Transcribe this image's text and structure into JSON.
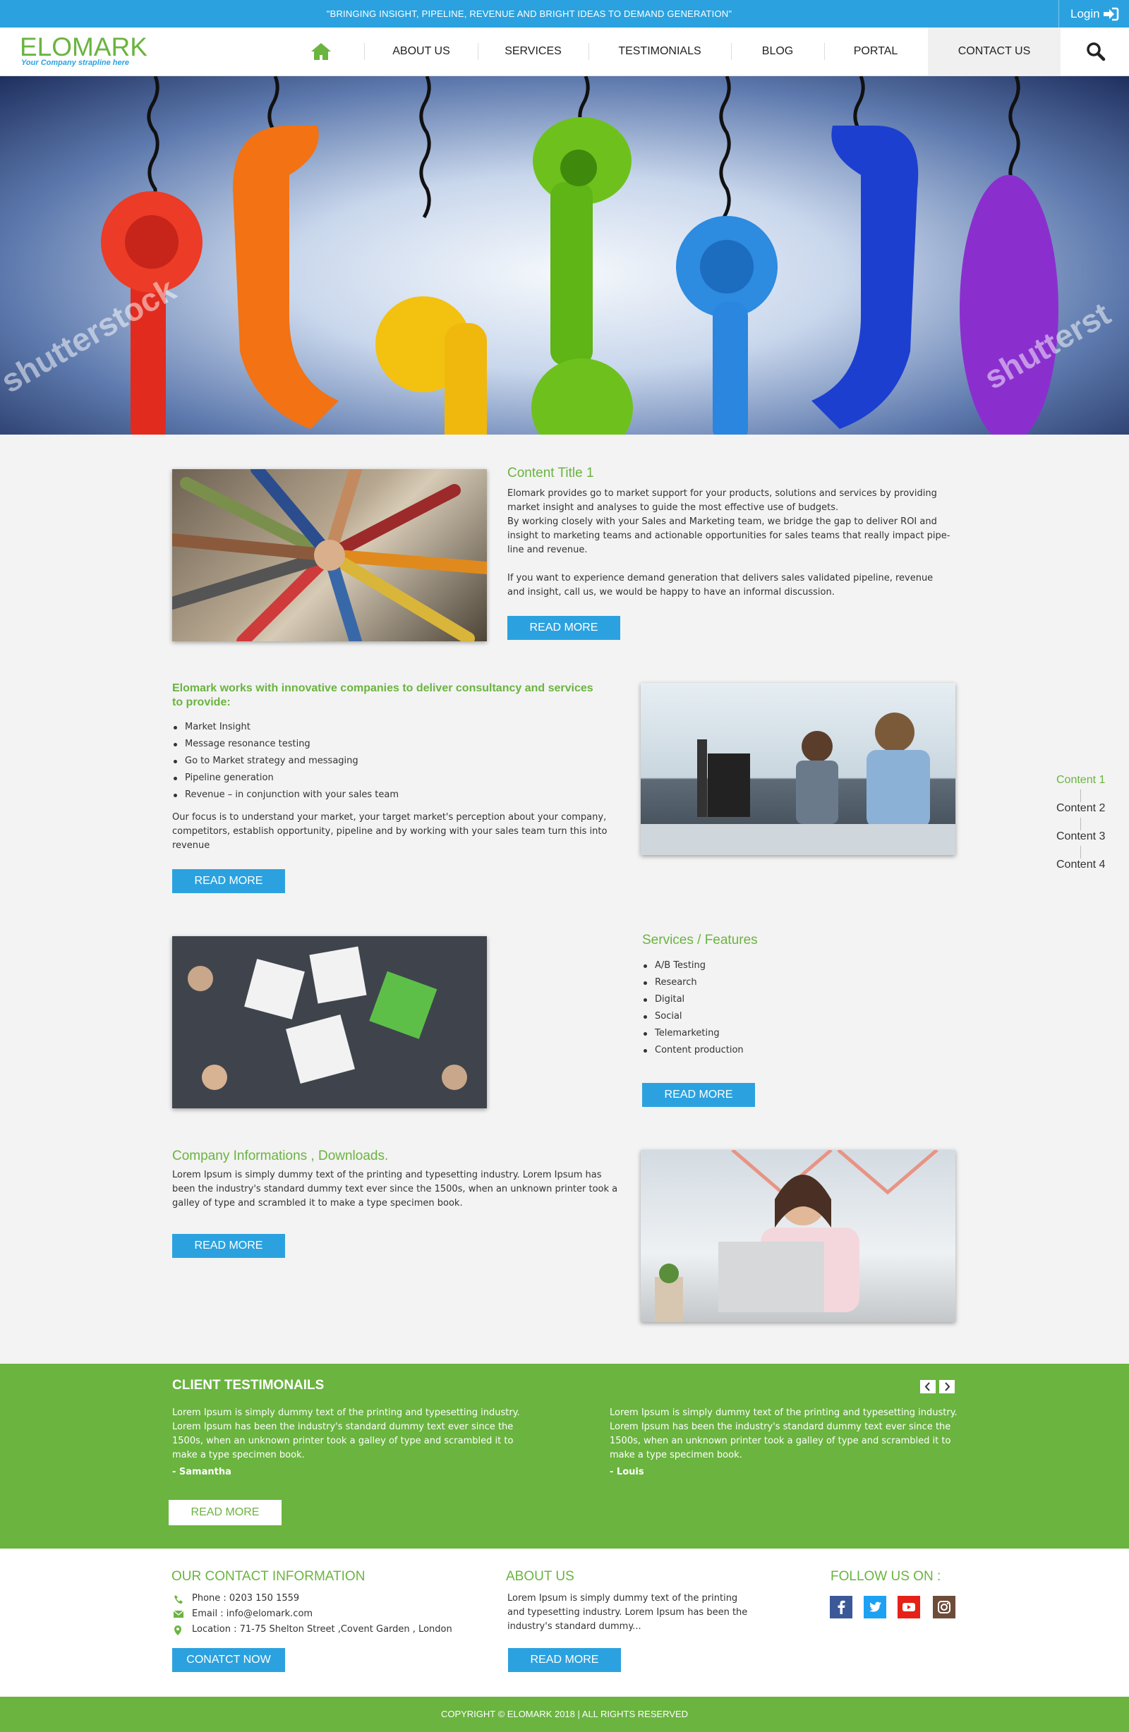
{
  "topbar": {
    "tagline": "\"BRINGING INSIGHT, PIPELINE, REVENUE AND BRIGHT IDEAS TO DEMAND GENERATION\"",
    "login_label": "Login"
  },
  "brand": {
    "logo_text": "ELOMARK",
    "strapline": "Your Company strapline here"
  },
  "nav": {
    "items": [
      "ABOUT US",
      "SERVICES",
      "TESTIMONIALS",
      "BLOG",
      "PORTAL",
      "CONTACT US"
    ]
  },
  "content1": {
    "title": "Content Title 1",
    "para1": "Elomark provides go to market support for your products, solutions and services by providing market insight and analyses to guide the most effective use of budgets.",
    "para2": "By working closely with your Sales and Marketing team, we bridge the gap to deliver ROI and insight to marketing teams and actionable opportunities for sales teams that really impact pipe-line and revenue.",
    "para3": "If you want to experience demand generation that delivers sales validated pipeline, revenue and insight, call us, we would be happy to have an informal discussion.",
    "button": "READ MORE"
  },
  "content2": {
    "title": "Elomark works with innovative companies to deliver consultancy and services to provide:",
    "bullets": [
      "Market Insight",
      "Message resonance testing",
      "Go to Market strategy and messaging",
      "Pipeline generation",
      "Revenue – in conjunction with your sales team"
    ],
    "para": "Our focus is to understand your market, your target market's perception about your company, competitors, establish opportunity, pipeline and by working with your sales team turn this into revenue",
    "button": "READ MORE"
  },
  "content3": {
    "title": "Services / Features",
    "bullets": [
      "A/B Testing",
      "Research",
      "Digital",
      "Social",
      "Telemarketing",
      "Content production"
    ],
    "button": "READ MORE"
  },
  "content4": {
    "title": "Company Informations , Downloads.",
    "para": "Lorem Ipsum is simply dummy text of the printing and typesetting industry. Lorem Ipsum has been the industry's standard dummy text ever since the 1500s, when an unknown printer took a galley of type and scrambled it to make a type specimen book.",
    "button": "READ MORE"
  },
  "side_nav": {
    "items": [
      "Content 1",
      "Content 2",
      "Content 3",
      "Content 4"
    ],
    "active_color": "#6ab43f"
  },
  "testimonials": {
    "title": "CLIENT TESTIMONAILS",
    "quotes": [
      {
        "text": "Lorem Ipsum is simply dummy text of the printing and typesetting industry. Lorem Ipsum has been the industry's standard dummy text ever since the 1500s, when an unknown printer took a galley of type and scrambled it to make a type specimen book.",
        "author": "- Samantha"
      },
      {
        "text": "Lorem Ipsum is simply dummy text of the printing and typesetting industry. Lorem Ipsum has been the industry's standard dummy text ever since the 1500s, when an unknown printer took a galley of type and scrambled it to make a type specimen book.",
        "author": "- Louis"
      }
    ],
    "button": "READ MORE"
  },
  "contact": {
    "title": "OUR CONTACT INFORMATION",
    "phone": "Phone : 0203 150 1559",
    "email": "Email : info@elomark.com",
    "location": "Location : 71-75 Shelton Street ,Covent Garden , London",
    "button": "CONATCT NOW"
  },
  "about": {
    "title": "ABOUT US",
    "text": "Lorem Ipsum is simply dummy text of the printing and typesetting industry. Lorem Ipsum has been the industry's standard dummy...",
    "button": "READ MORE"
  },
  "follow": {
    "title": "FOLLOW US ON :",
    "icons": [
      "facebook-icon",
      "twitter-icon",
      "youtube-icon",
      "instagram-icon"
    ]
  },
  "footer": {
    "copyright": "COPYRIGHT © ELOMARK 2018 | ALL RIGHTS RESERVED"
  },
  "colors": {
    "brand_blue": "#2ba2df",
    "brand_green": "#6ab43f"
  }
}
